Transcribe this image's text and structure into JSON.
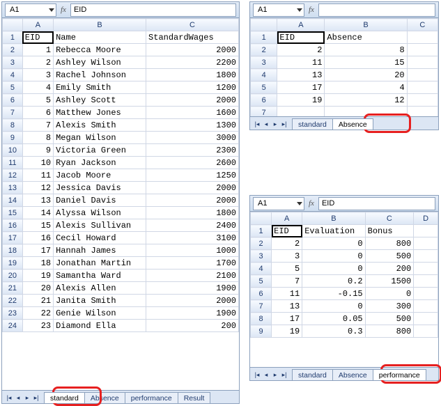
{
  "panel1": {
    "nameboxCell": "A1",
    "formulaValue": "EID",
    "cols": [
      "A",
      "B",
      "C"
    ],
    "widths": [
      40,
      120,
      120
    ],
    "headerRow": [
      "EID",
      "Name",
      "StandardWages"
    ],
    "rows": [
      [
        "1",
        "Rebecca Moore",
        "2000"
      ],
      [
        "2",
        "Ashley Wilson",
        "2200"
      ],
      [
        "3",
        "Rachel Johnson",
        "1800"
      ],
      [
        "4",
        "Emily Smith",
        "1200"
      ],
      [
        "5",
        "Ashley Scott",
        "2000"
      ],
      [
        "6",
        "Matthew Jones",
        "1600"
      ],
      [
        "7",
        "Alexis Smith",
        "1300"
      ],
      [
        "8",
        "Megan Wilson",
        "3000"
      ],
      [
        "9",
        "Victoria Green",
        "2300"
      ],
      [
        "10",
        "Ryan Jackson",
        "2600"
      ],
      [
        "11",
        "Jacob Moore",
        "1250"
      ],
      [
        "12",
        "Jessica Davis",
        "2000"
      ],
      [
        "13",
        "Daniel Davis",
        "2000"
      ],
      [
        "14",
        "Alyssa Wilson",
        "1800"
      ],
      [
        "15",
        "Alexis Sullivan",
        "2400"
      ],
      [
        "16",
        "Cecil Howard",
        "3100"
      ],
      [
        "17",
        "Hannah James",
        "1000"
      ],
      [
        "18",
        "Jonathan Martin",
        "1700"
      ],
      [
        "19",
        "Samantha Ward",
        "2100"
      ],
      [
        "20",
        "Alexis Allen",
        "1900"
      ],
      [
        "21",
        "Janita Smith",
        "2000"
      ],
      [
        "22",
        "Genie Wilson",
        "1900"
      ],
      [
        "23",
        "Diamond Ella",
        "200"
      ]
    ],
    "tabs": [
      "standard",
      "Absence",
      "performance",
      "Result"
    ],
    "activeTab": 0
  },
  "panel2": {
    "nameboxCell": "A1",
    "cols": [
      "A",
      "B",
      "C"
    ],
    "widths": [
      46,
      80,
      30
    ],
    "headerRow": [
      "EID",
      "Absence",
      ""
    ],
    "rows": [
      [
        "2",
        "8",
        ""
      ],
      [
        "11",
        "15",
        ""
      ],
      [
        "13",
        "20",
        ""
      ],
      [
        "17",
        "4",
        ""
      ],
      [
        "19",
        "12",
        ""
      ],
      [
        "",
        "",
        ""
      ]
    ],
    "tabs": [
      "standard",
      "Absence"
    ],
    "activeTab": 1
  },
  "panel3": {
    "nameboxCell": "A1",
    "formulaValue": "EID",
    "cols": [
      "A",
      "B",
      "C",
      "D"
    ],
    "widths": [
      38,
      78,
      60,
      30
    ],
    "headerRow": [
      "EID",
      "Evaluation",
      "Bonus",
      ""
    ],
    "rows": [
      [
        "2",
        "0",
        "800",
        ""
      ],
      [
        "3",
        "0",
        "500",
        ""
      ],
      [
        "5",
        "0",
        "200",
        ""
      ],
      [
        "7",
        "0.2",
        "1500",
        ""
      ],
      [
        "11",
        "-0.15",
        "0",
        ""
      ],
      [
        "13",
        "0",
        "300",
        ""
      ],
      [
        "17",
        "0.05",
        "500",
        ""
      ],
      [
        "19",
        "0.3",
        "800",
        ""
      ]
    ],
    "tabs": [
      "standard",
      "Absence",
      "performance"
    ],
    "activeTab": 2
  },
  "fxLabel": "fx",
  "nav": [
    "|◂",
    "◂",
    "▸",
    "▸|"
  ]
}
